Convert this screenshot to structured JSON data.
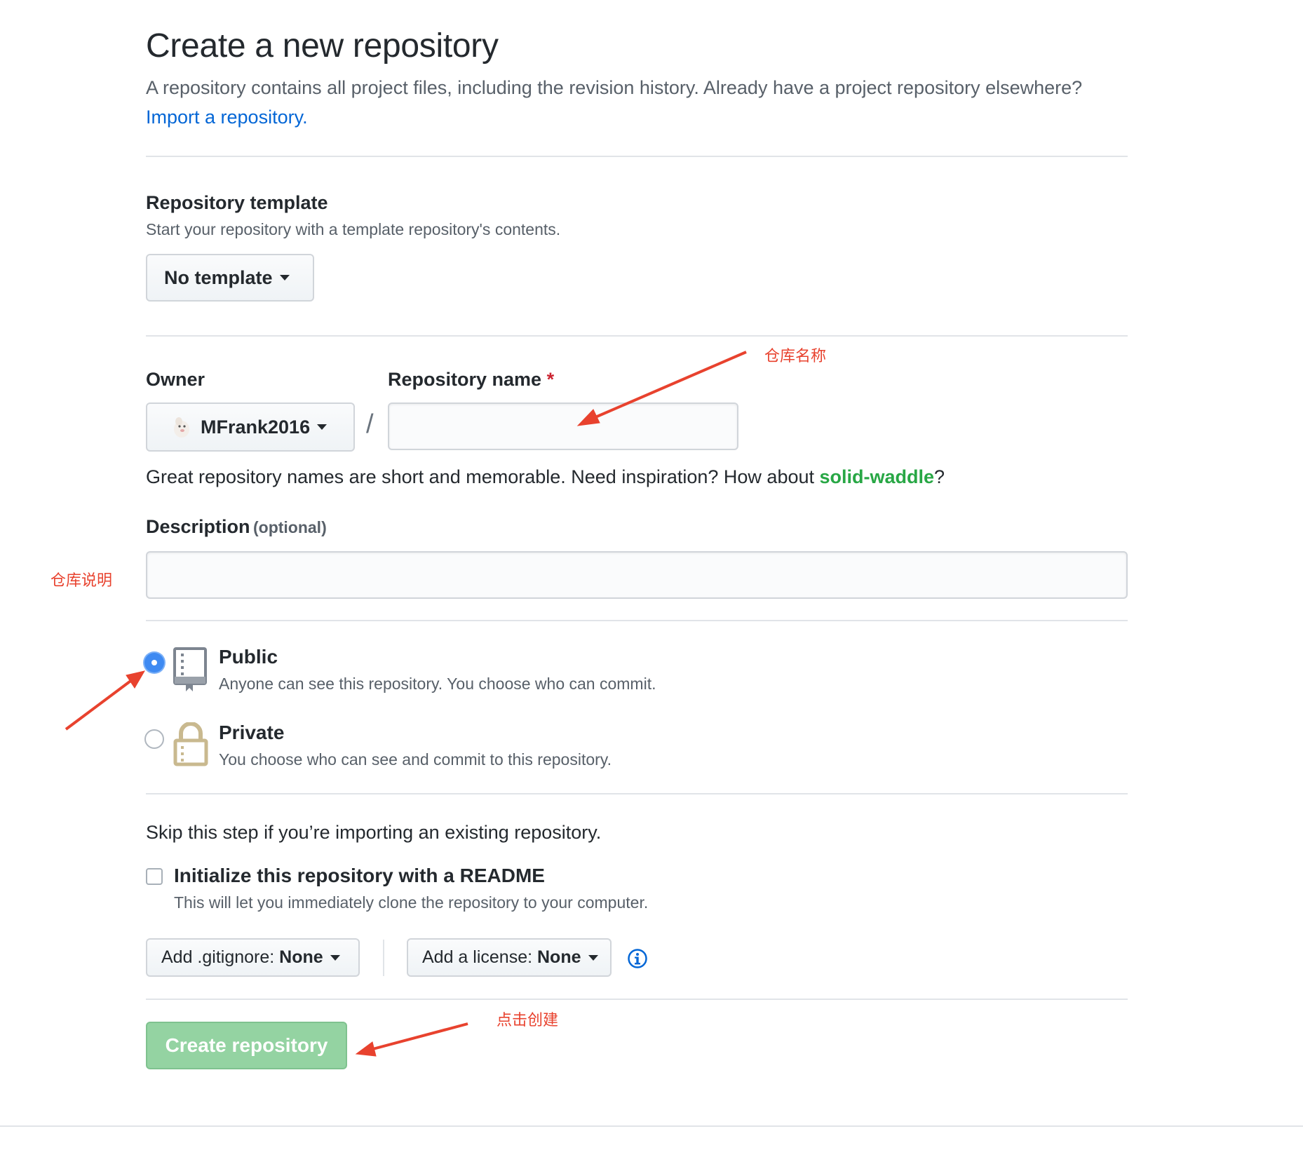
{
  "header": {
    "title": "Create a new repository",
    "subtitle_prefix": "A repository contains all project files, including the revision history. Already have a project repository elsewhere?",
    "import_link": "Import a repository."
  },
  "template": {
    "label": "Repository template",
    "help": "Start your repository with a template repository's contents.",
    "button": "No template"
  },
  "owner": {
    "label": "Owner",
    "value": "MFrank2016",
    "separator": "/"
  },
  "repo_name": {
    "label": "Repository name",
    "required_mark": "*",
    "value": ""
  },
  "name_hint": {
    "prefix": "Great repository names are short and memorable. Need inspiration? How about",
    "suggestion": "solid-waddle",
    "suffix": "?"
  },
  "description": {
    "label": "Description",
    "optional": "(optional)",
    "value": ""
  },
  "visibility": {
    "selected": "public",
    "public": {
      "title": "Public",
      "desc": "Anyone can see this repository. You choose who can commit."
    },
    "private": {
      "title": "Private",
      "desc": "You choose who can see and commit to this repository."
    }
  },
  "init": {
    "skip_note": "Skip this step if you’re importing an existing repository.",
    "readme_label": "Initialize this repository with a README",
    "readme_desc": "This will let you immediately clone the repository to your computer.",
    "readme_checked": false,
    "gitignore_prefix": "Add .gitignore:",
    "gitignore_value": "None",
    "license_prefix": "Add a license:",
    "license_value": "None"
  },
  "submit": {
    "label": "Create repository"
  },
  "annotations": {
    "repo_name": "仓库名称",
    "description": "仓库说明",
    "create": "点击创建"
  },
  "colors": {
    "link": "#0366d6",
    "suggestion": "#28a745",
    "required": "#cb2431",
    "create_button": "#94d3a2",
    "annotation": "#e8422e",
    "radio_checked": "#3e8af2"
  }
}
